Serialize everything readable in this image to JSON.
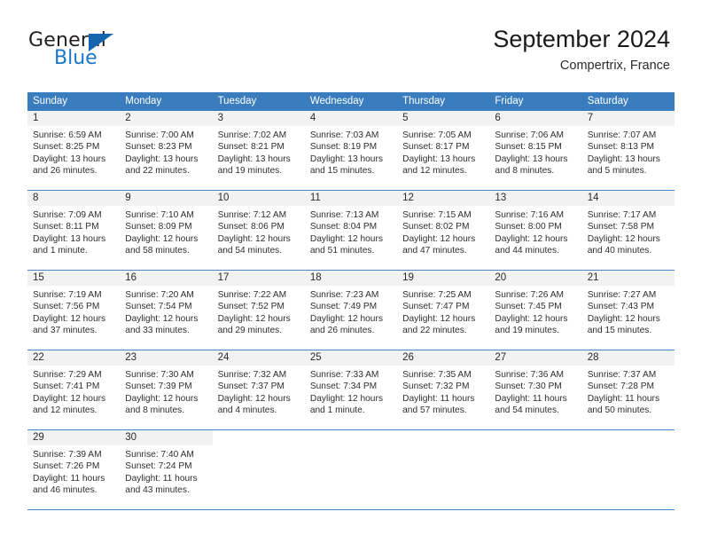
{
  "brand": {
    "name_top": "General",
    "name_bottom": "Blue",
    "triangle_color": "#1565b0",
    "blue_text_color": "#1976c8"
  },
  "header": {
    "title": "September 2024",
    "subtitle": "Compertrix, France"
  },
  "theme": {
    "header_row_bg": "#3a7dbf",
    "daynum_band_bg": "#f2f2f2",
    "row_divider": "#4a86c5"
  },
  "weekdays": [
    "Sunday",
    "Monday",
    "Tuesday",
    "Wednesday",
    "Thursday",
    "Friday",
    "Saturday"
  ],
  "weeks": [
    [
      {
        "day": "1",
        "sunrise": "Sunrise: 6:59 AM",
        "sunset": "Sunset: 8:25 PM",
        "daylight1": "Daylight: 13 hours",
        "daylight2": "and 26 minutes."
      },
      {
        "day": "2",
        "sunrise": "Sunrise: 7:00 AM",
        "sunset": "Sunset: 8:23 PM",
        "daylight1": "Daylight: 13 hours",
        "daylight2": "and 22 minutes."
      },
      {
        "day": "3",
        "sunrise": "Sunrise: 7:02 AM",
        "sunset": "Sunset: 8:21 PM",
        "daylight1": "Daylight: 13 hours",
        "daylight2": "and 19 minutes."
      },
      {
        "day": "4",
        "sunrise": "Sunrise: 7:03 AM",
        "sunset": "Sunset: 8:19 PM",
        "daylight1": "Daylight: 13 hours",
        "daylight2": "and 15 minutes."
      },
      {
        "day": "5",
        "sunrise": "Sunrise: 7:05 AM",
        "sunset": "Sunset: 8:17 PM",
        "daylight1": "Daylight: 13 hours",
        "daylight2": "and 12 minutes."
      },
      {
        "day": "6",
        "sunrise": "Sunrise: 7:06 AM",
        "sunset": "Sunset: 8:15 PM",
        "daylight1": "Daylight: 13 hours",
        "daylight2": "and 8 minutes."
      },
      {
        "day": "7",
        "sunrise": "Sunrise: 7:07 AM",
        "sunset": "Sunset: 8:13 PM",
        "daylight1": "Daylight: 13 hours",
        "daylight2": "and 5 minutes."
      }
    ],
    [
      {
        "day": "8",
        "sunrise": "Sunrise: 7:09 AM",
        "sunset": "Sunset: 8:11 PM",
        "daylight1": "Daylight: 13 hours",
        "daylight2": "and 1 minute."
      },
      {
        "day": "9",
        "sunrise": "Sunrise: 7:10 AM",
        "sunset": "Sunset: 8:09 PM",
        "daylight1": "Daylight: 12 hours",
        "daylight2": "and 58 minutes."
      },
      {
        "day": "10",
        "sunrise": "Sunrise: 7:12 AM",
        "sunset": "Sunset: 8:06 PM",
        "daylight1": "Daylight: 12 hours",
        "daylight2": "and 54 minutes."
      },
      {
        "day": "11",
        "sunrise": "Sunrise: 7:13 AM",
        "sunset": "Sunset: 8:04 PM",
        "daylight1": "Daylight: 12 hours",
        "daylight2": "and 51 minutes."
      },
      {
        "day": "12",
        "sunrise": "Sunrise: 7:15 AM",
        "sunset": "Sunset: 8:02 PM",
        "daylight1": "Daylight: 12 hours",
        "daylight2": "and 47 minutes."
      },
      {
        "day": "13",
        "sunrise": "Sunrise: 7:16 AM",
        "sunset": "Sunset: 8:00 PM",
        "daylight1": "Daylight: 12 hours",
        "daylight2": "and 44 minutes."
      },
      {
        "day": "14",
        "sunrise": "Sunrise: 7:17 AM",
        "sunset": "Sunset: 7:58 PM",
        "daylight1": "Daylight: 12 hours",
        "daylight2": "and 40 minutes."
      }
    ],
    [
      {
        "day": "15",
        "sunrise": "Sunrise: 7:19 AM",
        "sunset": "Sunset: 7:56 PM",
        "daylight1": "Daylight: 12 hours",
        "daylight2": "and 37 minutes."
      },
      {
        "day": "16",
        "sunrise": "Sunrise: 7:20 AM",
        "sunset": "Sunset: 7:54 PM",
        "daylight1": "Daylight: 12 hours",
        "daylight2": "and 33 minutes."
      },
      {
        "day": "17",
        "sunrise": "Sunrise: 7:22 AM",
        "sunset": "Sunset: 7:52 PM",
        "daylight1": "Daylight: 12 hours",
        "daylight2": "and 29 minutes."
      },
      {
        "day": "18",
        "sunrise": "Sunrise: 7:23 AM",
        "sunset": "Sunset: 7:49 PM",
        "daylight1": "Daylight: 12 hours",
        "daylight2": "and 26 minutes."
      },
      {
        "day": "19",
        "sunrise": "Sunrise: 7:25 AM",
        "sunset": "Sunset: 7:47 PM",
        "daylight1": "Daylight: 12 hours",
        "daylight2": "and 22 minutes."
      },
      {
        "day": "20",
        "sunrise": "Sunrise: 7:26 AM",
        "sunset": "Sunset: 7:45 PM",
        "daylight1": "Daylight: 12 hours",
        "daylight2": "and 19 minutes."
      },
      {
        "day": "21",
        "sunrise": "Sunrise: 7:27 AM",
        "sunset": "Sunset: 7:43 PM",
        "daylight1": "Daylight: 12 hours",
        "daylight2": "and 15 minutes."
      }
    ],
    [
      {
        "day": "22",
        "sunrise": "Sunrise: 7:29 AM",
        "sunset": "Sunset: 7:41 PM",
        "daylight1": "Daylight: 12 hours",
        "daylight2": "and 12 minutes."
      },
      {
        "day": "23",
        "sunrise": "Sunrise: 7:30 AM",
        "sunset": "Sunset: 7:39 PM",
        "daylight1": "Daylight: 12 hours",
        "daylight2": "and 8 minutes."
      },
      {
        "day": "24",
        "sunrise": "Sunrise: 7:32 AM",
        "sunset": "Sunset: 7:37 PM",
        "daylight1": "Daylight: 12 hours",
        "daylight2": "and 4 minutes."
      },
      {
        "day": "25",
        "sunrise": "Sunrise: 7:33 AM",
        "sunset": "Sunset: 7:34 PM",
        "daylight1": "Daylight: 12 hours",
        "daylight2": "and 1 minute."
      },
      {
        "day": "26",
        "sunrise": "Sunrise: 7:35 AM",
        "sunset": "Sunset: 7:32 PM",
        "daylight1": "Daylight: 11 hours",
        "daylight2": "and 57 minutes."
      },
      {
        "day": "27",
        "sunrise": "Sunrise: 7:36 AM",
        "sunset": "Sunset: 7:30 PM",
        "daylight1": "Daylight: 11 hours",
        "daylight2": "and 54 minutes."
      },
      {
        "day": "28",
        "sunrise": "Sunrise: 7:37 AM",
        "sunset": "Sunset: 7:28 PM",
        "daylight1": "Daylight: 11 hours",
        "daylight2": "and 50 minutes."
      }
    ],
    [
      {
        "day": "29",
        "sunrise": "Sunrise: 7:39 AM",
        "sunset": "Sunset: 7:26 PM",
        "daylight1": "Daylight: 11 hours",
        "daylight2": "and 46 minutes."
      },
      {
        "day": "30",
        "sunrise": "Sunrise: 7:40 AM",
        "sunset": "Sunset: 7:24 PM",
        "daylight1": "Daylight: 11 hours",
        "daylight2": "and 43 minutes."
      },
      {
        "day": "",
        "sunrise": "",
        "sunset": "",
        "daylight1": "",
        "daylight2": ""
      },
      {
        "day": "",
        "sunrise": "",
        "sunset": "",
        "daylight1": "",
        "daylight2": ""
      },
      {
        "day": "",
        "sunrise": "",
        "sunset": "",
        "daylight1": "",
        "daylight2": ""
      },
      {
        "day": "",
        "sunrise": "",
        "sunset": "",
        "daylight1": "",
        "daylight2": ""
      },
      {
        "day": "",
        "sunrise": "",
        "sunset": "",
        "daylight1": "",
        "daylight2": ""
      }
    ]
  ]
}
